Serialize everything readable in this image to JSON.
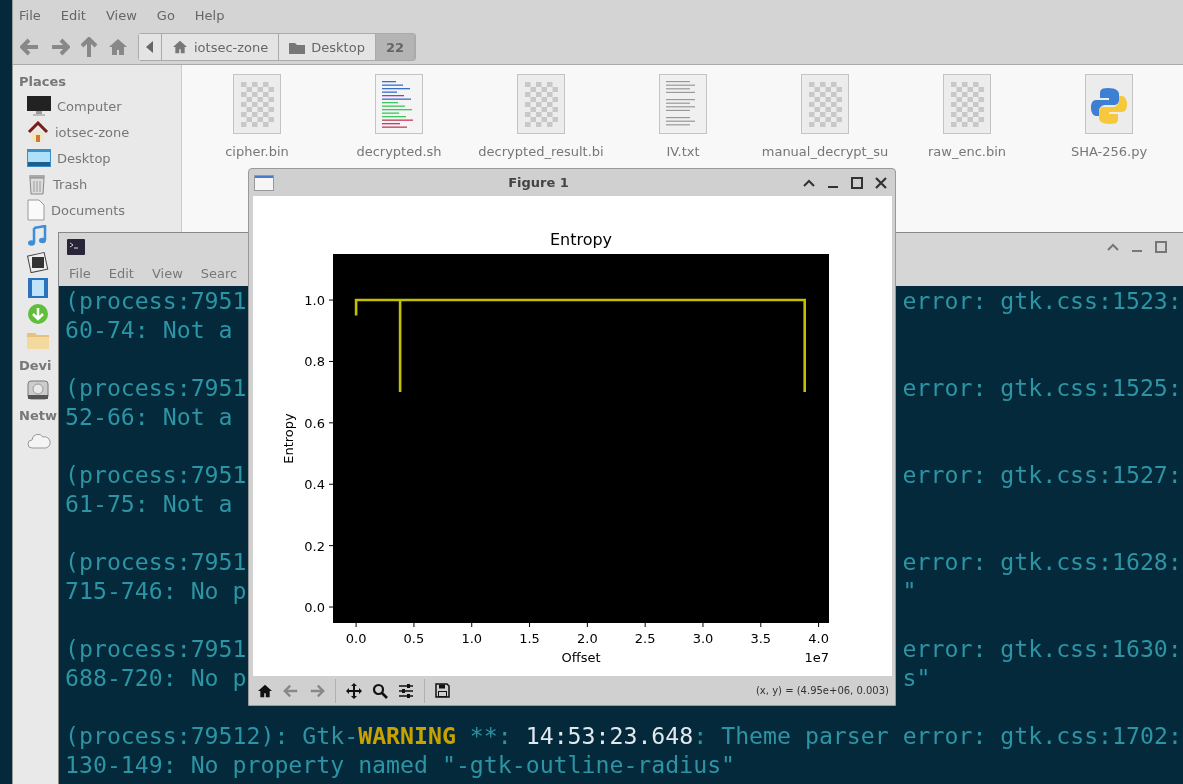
{
  "file_manager": {
    "menu": [
      "File",
      "Edit",
      "View",
      "Go",
      "Help"
    ],
    "path": [
      {
        "label": "iotsec-zone",
        "kind": "home",
        "selected": false
      },
      {
        "label": "Desktop",
        "kind": "folder",
        "selected": false
      },
      {
        "label": "22",
        "kind": "plain",
        "selected": true
      }
    ],
    "sidebar": [
      {
        "title": "Places",
        "items": [
          {
            "label": "Computer",
            "kind": "computer"
          },
          {
            "label": "iotsec-zone",
            "kind": "home"
          },
          {
            "label": "Desktop",
            "kind": "desktop"
          },
          {
            "label": "Trash",
            "kind": "trash"
          },
          {
            "label": "Documents",
            "kind": "document"
          },
          {
            "kind": "music"
          },
          {
            "kind": "pictures"
          },
          {
            "kind": "videos"
          },
          {
            "kind": "downloads"
          },
          {
            "kind": "folder"
          }
        ]
      },
      {
        "title": "Devi",
        "items": [
          {
            "kind": "drive"
          }
        ]
      },
      {
        "title": "Netw",
        "items": [
          {
            "kind": "network"
          }
        ]
      }
    ],
    "files": [
      {
        "name": "cipher.bin",
        "kind": "binary"
      },
      {
        "name": "decrypted.sh",
        "kind": "script"
      },
      {
        "name": "decrypted_result.bi",
        "kind": "binary"
      },
      {
        "name": "IV.txt",
        "kind": "text"
      },
      {
        "name": "manual_decrypt_su",
        "kind": "binary"
      },
      {
        "name": "raw_enc.bin",
        "kind": "binary"
      },
      {
        "name": "SHA-256.py",
        "kind": "python"
      }
    ]
  },
  "terminal": {
    "menu": [
      "File",
      "Edit",
      "View",
      "Searc"
    ],
    "messages": [
      {
        "lines": [
          {
            "segments": [
              {
                "text": "(process:7951",
                "kind": "plain"
              }
            ],
            "right": "error: gtk.css:1523:"
          },
          {
            "segments": [
              {
                "text": "60-74: Not a",
                "kind": "plain"
              }
            ]
          }
        ]
      },
      {
        "lines": [
          {
            "segments": [
              {
                "text": "(process:7951",
                "kind": "plain"
              }
            ],
            "right": "error: gtk.css:1525:"
          },
          {
            "segments": [
              {
                "text": "52-66: Not a",
                "kind": "plain"
              }
            ]
          }
        ]
      },
      {
        "lines": [
          {
            "segments": [
              {
                "text": "(process:7951",
                "kind": "plain"
              }
            ],
            "right": "error: gtk.css:1527:"
          },
          {
            "segments": [
              {
                "text": "61-75: Not a",
                "kind": "plain"
              }
            ]
          }
        ]
      },
      {
        "lines": [
          {
            "segments": [
              {
                "text": "(process:7951",
                "kind": "plain"
              }
            ],
            "right": "error: gtk.css:1628:"
          },
          {
            "segments": [
              {
                "text": "715-746: No p",
                "kind": "plain"
              }
            ],
            "right": "\""
          }
        ]
      },
      {
        "lines": [
          {
            "segments": [
              {
                "text": "(process:7951",
                "kind": "plain"
              }
            ],
            "right": "error: gtk.css:1630:"
          },
          {
            "segments": [
              {
                "text": "688-720: No p",
                "kind": "plain"
              }
            ],
            "right": "s\""
          }
        ]
      },
      {
        "lines": [
          {
            "segments": [
              {
                "text": "(process:79512): Gtk-",
                "kind": "plain"
              },
              {
                "text": "WARNING",
                "kind": "warning"
              },
              {
                "text": " **: ",
                "kind": "plain"
              },
              {
                "text": "14:53:23.648",
                "kind": "time"
              },
              {
                "text": ": Theme parser error: gtk.css:1702:",
                "kind": "plain"
              }
            ]
          },
          {
            "segments": [
              {
                "text": "130-149: No property named \"-gtk-outline-radius\"",
                "kind": "plain"
              }
            ]
          }
        ]
      }
    ]
  },
  "figure": {
    "title": "Figure 1",
    "x_offset_label": "1e7",
    "status": "(x, y) = (4.95e+06, 0.003)",
    "chart_data": {
      "type": "line",
      "title": "Entropy",
      "xlabel": "Offset",
      "ylabel": "Entropy",
      "x": [
        0,
        0,
        0.38,
        0.38,
        0.38,
        3.88,
        3.88
      ],
      "series": [
        {
          "color": "#c4c000",
          "values": [
            0.95,
            1.0,
            1.0,
            0.7,
            1.0,
            1.0,
            0.7
          ]
        }
      ],
      "xlim": [
        -0.2,
        4.09
      ],
      "ylim": [
        -0.052,
        1.15
      ],
      "xticks": [
        {
          "value": 0,
          "label": "0.0"
        },
        {
          "value": 0.5,
          "label": "0.5"
        },
        {
          "value": 1,
          "label": "1.0"
        },
        {
          "value": 1.5,
          "label": "1.5"
        },
        {
          "value": 2,
          "label": "2.0"
        },
        {
          "value": 2.5,
          "label": "2.5"
        },
        {
          "value": 3,
          "label": "3.0"
        },
        {
          "value": 3.5,
          "label": "3.5"
        },
        {
          "value": 4,
          "label": "4.0"
        }
      ],
      "yticks": [
        {
          "value": 0,
          "label": "0.0"
        },
        {
          "value": 0.2,
          "label": "0.2"
        },
        {
          "value": 0.4,
          "label": "0.4"
        },
        {
          "value": 0.6,
          "label": "0.6"
        },
        {
          "value": 0.8,
          "label": "0.8"
        },
        {
          "value": 1,
          "label": "1.0"
        }
      ]
    }
  }
}
